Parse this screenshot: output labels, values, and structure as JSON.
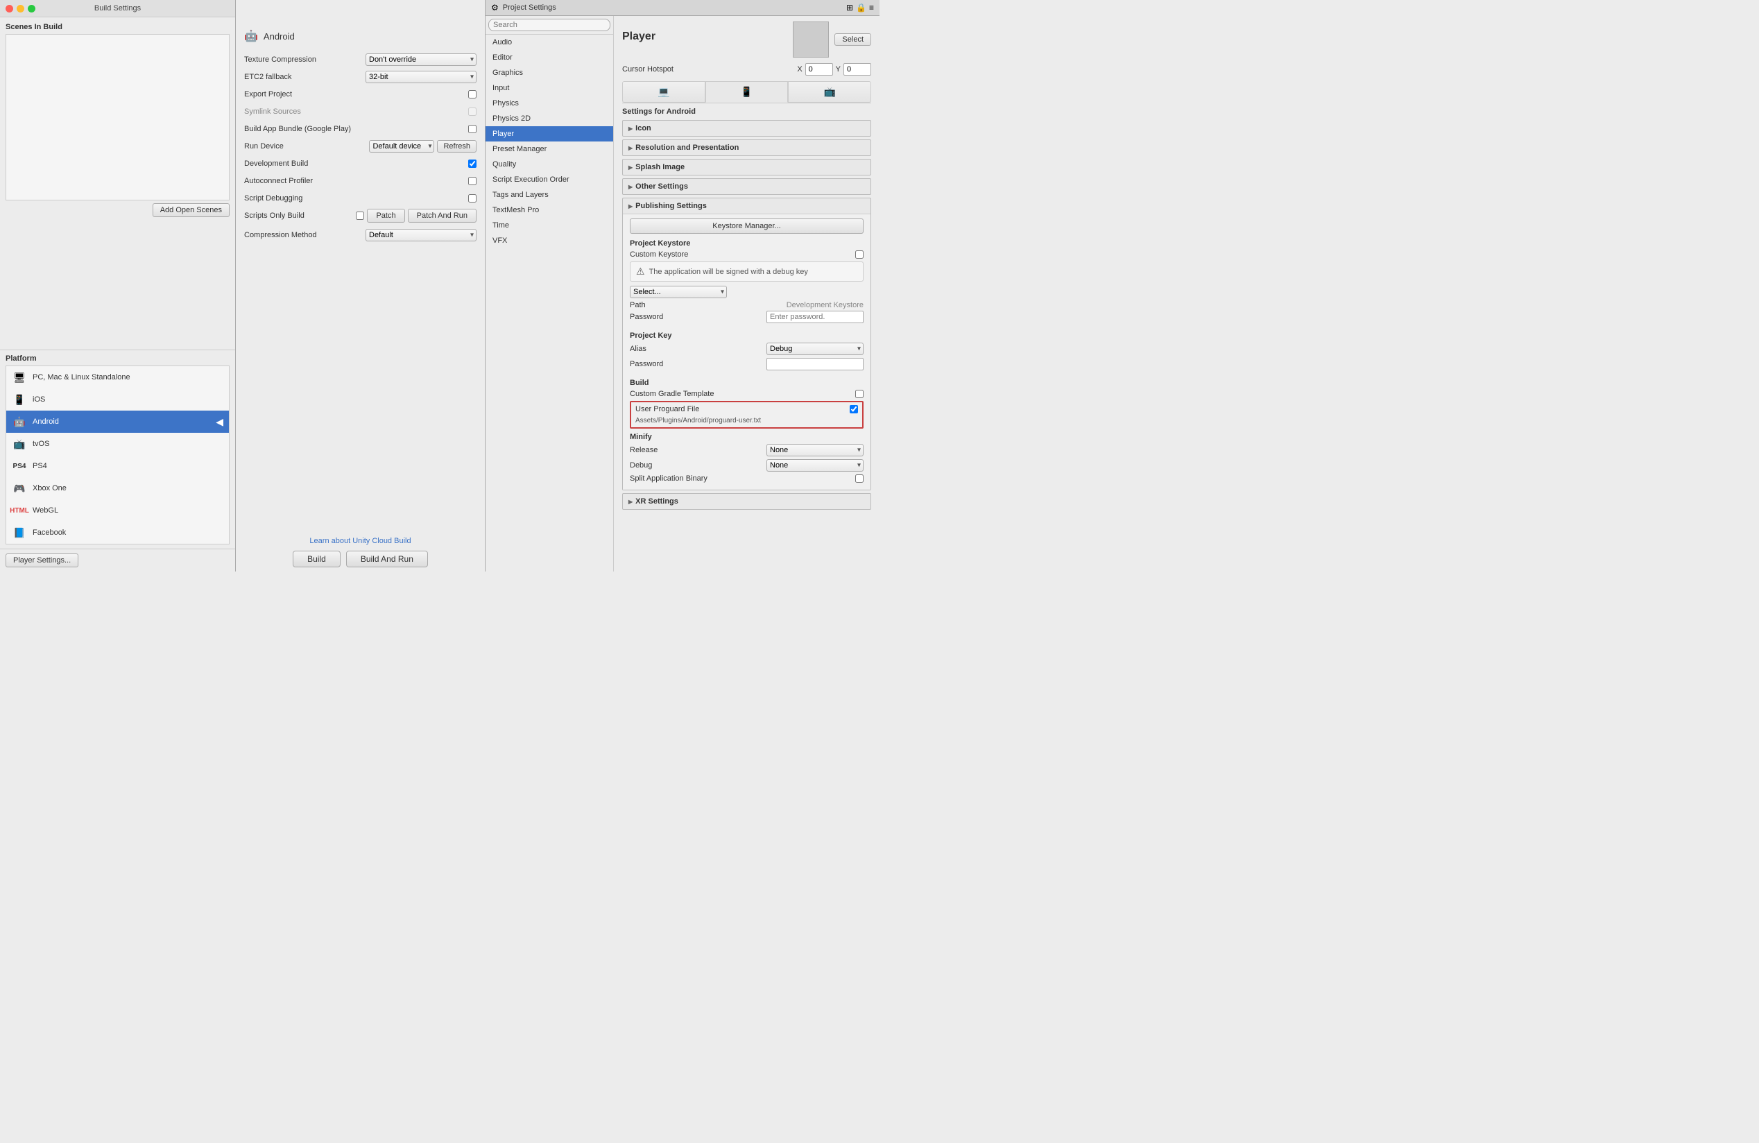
{
  "buildSettings": {
    "title": "Build Settings",
    "scenesLabel": "Scenes In Build",
    "addOpenScenesBtn": "Add Open Scenes",
    "platformLabel": "Platform",
    "platforms": [
      {
        "id": "standalone",
        "icon": "🖥",
        "name": "PC, Mac & Linux Standalone",
        "selected": false
      },
      {
        "id": "ios",
        "icon": "📱",
        "name": "iOS",
        "selected": false
      },
      {
        "id": "android",
        "icon": "🤖",
        "name": "Android",
        "selected": true
      },
      {
        "id": "tvos",
        "icon": "📺",
        "name": "tvOS",
        "selected": false
      },
      {
        "id": "ps4",
        "icon": "🎮",
        "name": "PS4",
        "selected": false
      },
      {
        "id": "xboxone",
        "icon": "🎮",
        "name": "Xbox One",
        "selected": false
      },
      {
        "id": "webgl",
        "icon": "🌐",
        "name": "WebGL",
        "selected": false
      },
      {
        "id": "facebook",
        "icon": "📘",
        "name": "Facebook",
        "selected": false
      }
    ],
    "playerSettingsBtn": "Player Settings...",
    "buildBtn": "Build",
    "buildAndRunBtn": "Build And Run"
  },
  "androidSettings": {
    "title": "Android",
    "textureCompressionLabel": "Texture Compression",
    "textureCompressionValue": "Don't override",
    "etc2FallbackLabel": "ETC2 fallback",
    "etc2FallbackValue": "32-bit",
    "exportProjectLabel": "Export Project",
    "symlinkSourcesLabel": "Symlink Sources",
    "buildAppBundleLabel": "Build App Bundle (Google Play)",
    "runDeviceLabel": "Run Device",
    "runDeviceValue": "Default device",
    "refreshBtn": "Refresh",
    "developmentBuildLabel": "Development Build",
    "autoconnectProfilerLabel": "Autoconnect Profiler",
    "scriptDebuggingLabel": "Script Debugging",
    "scriptsOnlyBuildLabel": "Scripts Only Build",
    "patchBtn": "Patch",
    "patchAndRunBtn": "Patch And Run",
    "compressionLabel": "Compression Method",
    "compressionValue": "Default",
    "learnLink": "Learn about Unity Cloud Build",
    "developmentBuildChecked": true
  },
  "projectSettings": {
    "title": "Project Settings",
    "searchPlaceholder": "Search",
    "navItems": [
      {
        "id": "audio",
        "label": "Audio",
        "selected": false
      },
      {
        "id": "editor",
        "label": "Editor",
        "selected": false
      },
      {
        "id": "graphics",
        "label": "Graphics",
        "selected": false
      },
      {
        "id": "input",
        "label": "Input",
        "selected": false
      },
      {
        "id": "physics",
        "label": "Physics",
        "selected": false
      },
      {
        "id": "physics2d",
        "label": "Physics 2D",
        "selected": false
      },
      {
        "id": "player",
        "label": "Player",
        "selected": true
      },
      {
        "id": "presetmanager",
        "label": "Preset Manager",
        "selected": false
      },
      {
        "id": "quality",
        "label": "Quality",
        "selected": false
      },
      {
        "id": "scriptexecution",
        "label": "Script Execution Order",
        "selected": false
      },
      {
        "id": "tagsandlayers",
        "label": "Tags and Layers",
        "selected": false
      },
      {
        "id": "textmeshpro",
        "label": "TextMesh Pro",
        "selected": false
      },
      {
        "id": "time",
        "label": "Time",
        "selected": false
      },
      {
        "id": "vfx",
        "label": "VFX",
        "selected": false
      }
    ],
    "mainTitle": "Player",
    "selectBtn": "Select",
    "cursorHotspotLabel": "Cursor Hotspot",
    "xLabel": "X",
    "yLabel": "Y",
    "xValue": "0",
    "yValue": "0",
    "platformTabs": [
      {
        "id": "standalone",
        "icon": "💻"
      },
      {
        "id": "android",
        "icon": "📱"
      },
      {
        "id": "tvos",
        "icon": "📺"
      }
    ],
    "settingsForLabel": "Settings for Android",
    "sections": {
      "icon": "Icon",
      "resolutionAndPresentation": "Resolution and Presentation",
      "splashImage": "Splash Image",
      "otherSettings": "Other Settings",
      "publishingSettings": "Publishing Settings",
      "xrSettings": "XR Settings"
    },
    "keystoreManagerBtn": "Keystore Manager...",
    "projectKeystoreLabel": "Project Keystore",
    "customKeystoreLabel": "Custom Keystore",
    "warningText": "The application will be signed with a debug key",
    "selectDropdownValue": "Select...",
    "pathLabel": "Path",
    "devKeystoreLabel": "Development Keystore",
    "passwordLabel": "Password",
    "enterPasswordPlaceholder": "Enter password.",
    "projectKeyLabel": "Project Key",
    "aliasLabel": "Alias",
    "aliasValue": "Debug",
    "passwordLabel2": "Password",
    "buildSectionLabel": "Build",
    "customGradleLabel": "Custom Gradle Template",
    "userProguardLabel": "User Proguard File",
    "proguardPath": "Assets/Plugins/Android/proguard-user.txt",
    "minifyLabel": "Minify",
    "releaseLabel": "Release",
    "releaseValue": "None",
    "debugLabel": "Debug",
    "debugValue": "None",
    "splitAppBinaryLabel": "Split Application Binary",
    "xrSettingsLabel": "XR Settings"
  }
}
